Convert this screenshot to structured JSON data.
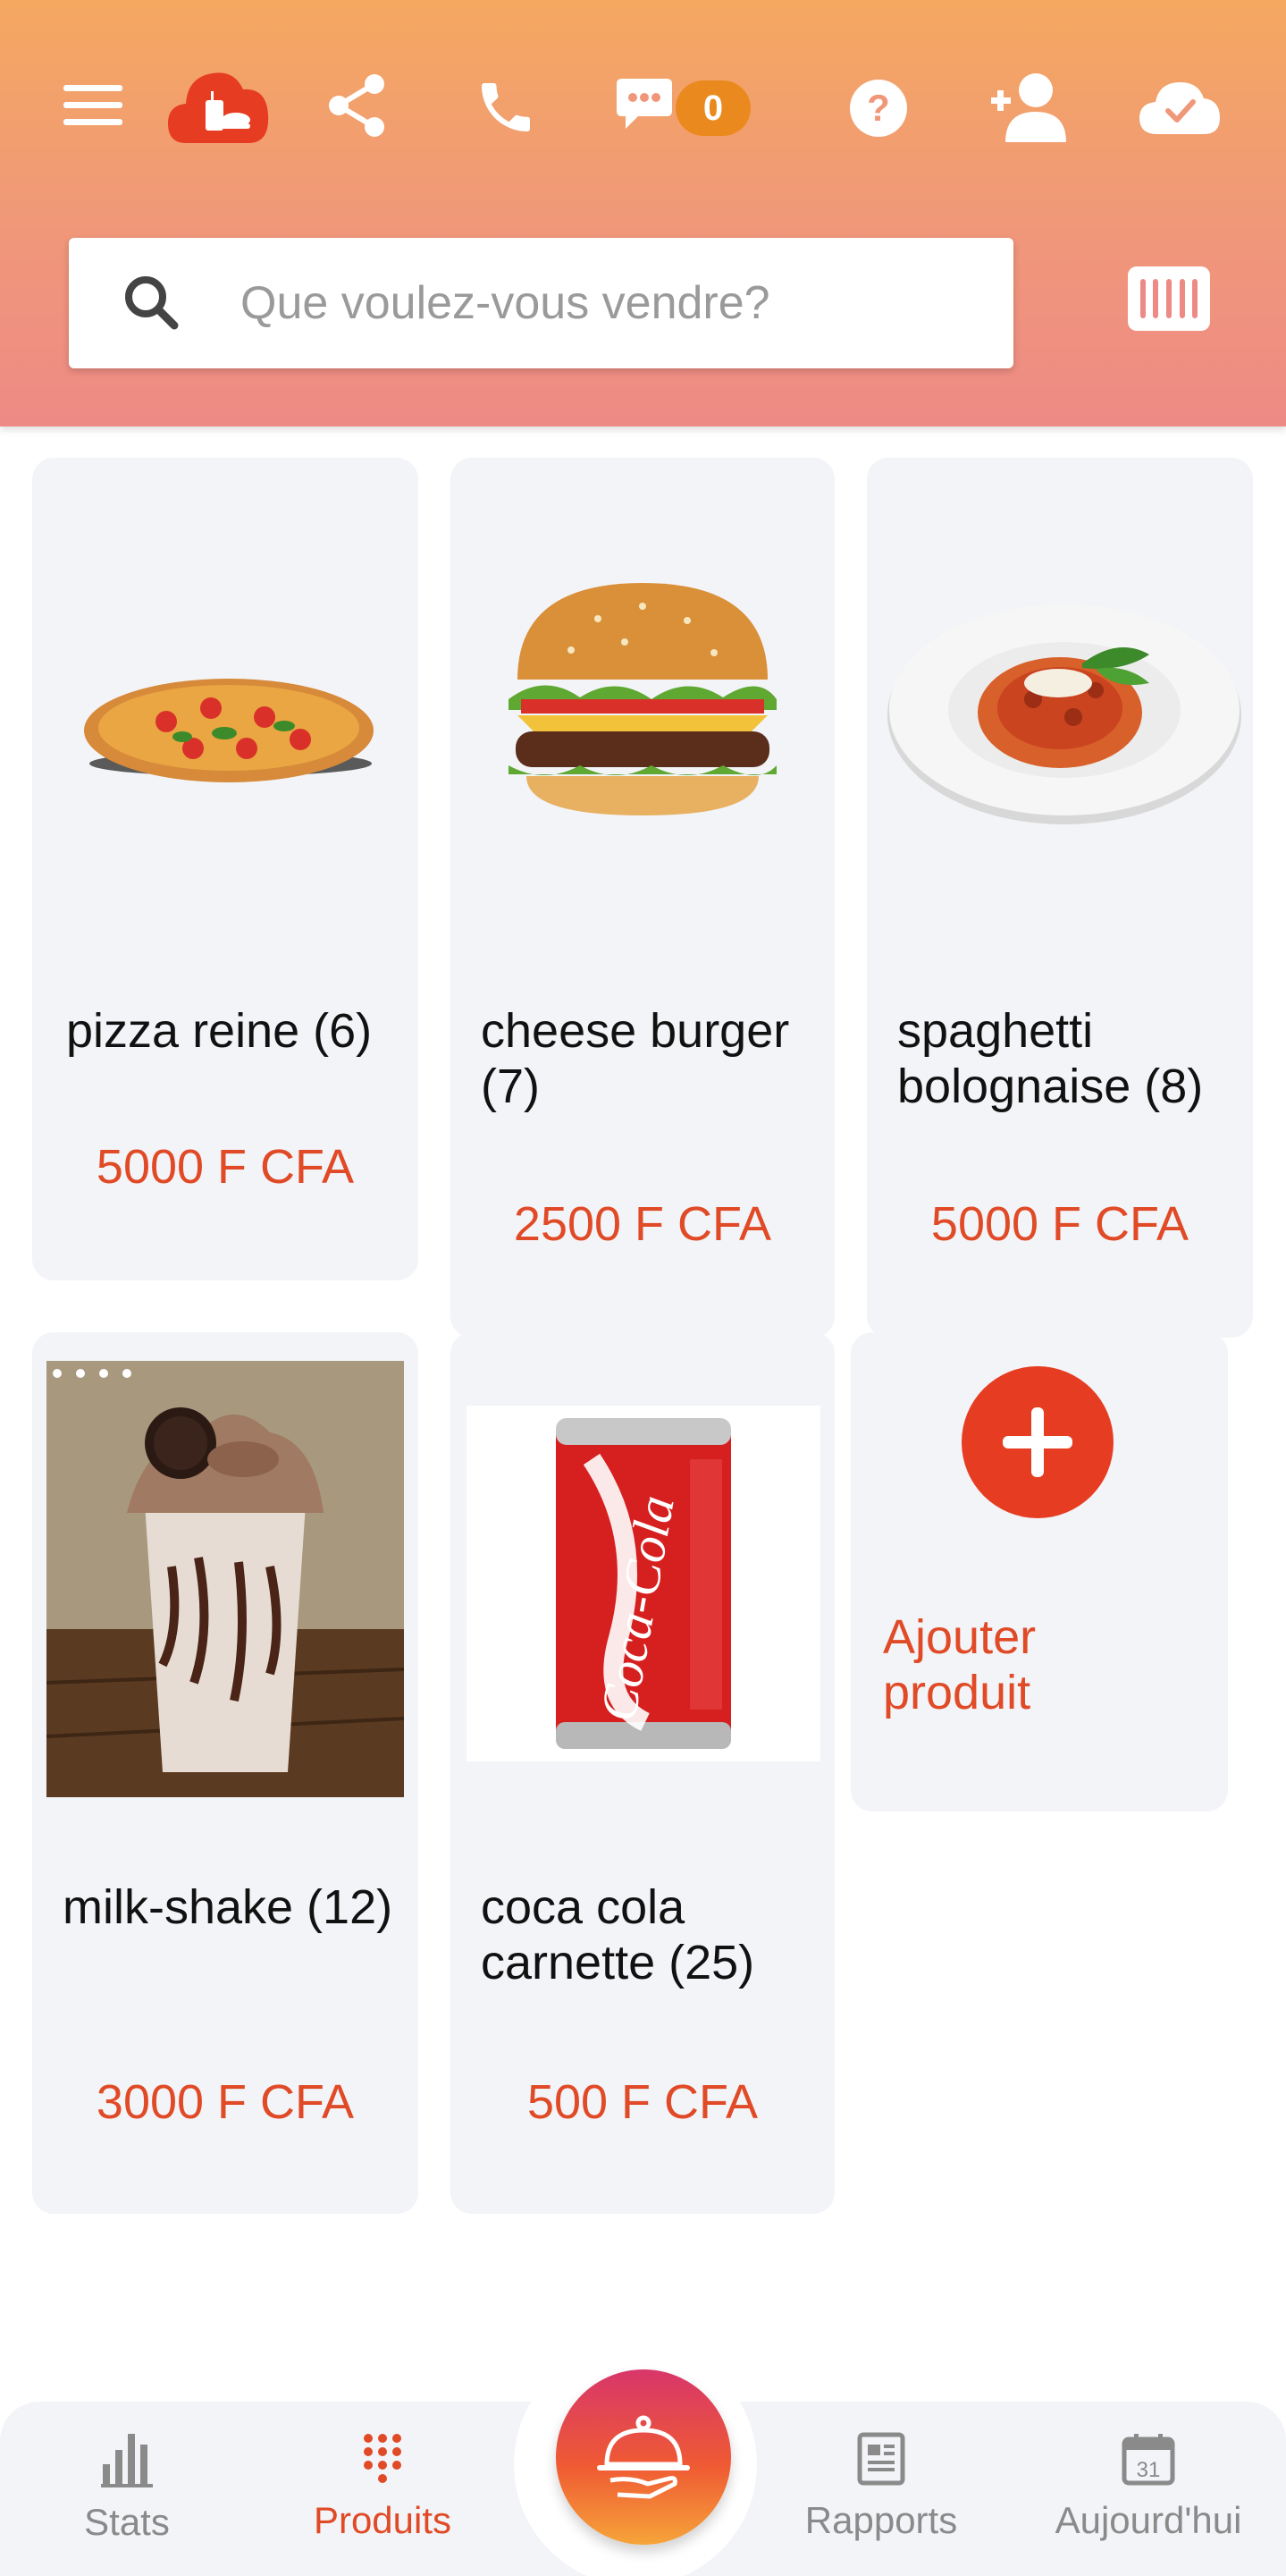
{
  "header": {
    "badge_count": "0",
    "search": {
      "placeholder": "Que voulez-vous vendre?"
    }
  },
  "products": [
    {
      "name": "pizza reine (6)",
      "price": "5000 F CFA"
    },
    {
      "name": "cheese burger (7)",
      "price": "2500 F CFA"
    },
    {
      "name": "spaghetti bolognaise (8)",
      "price": "5000 F CFA"
    },
    {
      "name": "milk-shake (12)",
      "price": "3000 F CFA"
    },
    {
      "name": "coca cola carnette (25)",
      "price": "500 F CFA"
    }
  ],
  "add_product": {
    "label": "Ajouter produit"
  },
  "bottom_nav": {
    "items": [
      {
        "label": "Stats",
        "icon": "bar-chart-icon",
        "active": false
      },
      {
        "label": "Produits",
        "icon": "grid-dots-icon",
        "active": true
      },
      {
        "label": "Rapports",
        "icon": "report-icon",
        "active": false
      },
      {
        "label": "Aujourd'hui",
        "icon": "calendar-icon",
        "active": false
      }
    ],
    "fab_icon": "serving-tray-icon"
  },
  "colors": {
    "accent": "#e04a26",
    "header_top": "#f4a860",
    "header_bottom": "#ee8a85",
    "badge": "#ea8a1e",
    "card_bg": "#f3f4f8"
  }
}
